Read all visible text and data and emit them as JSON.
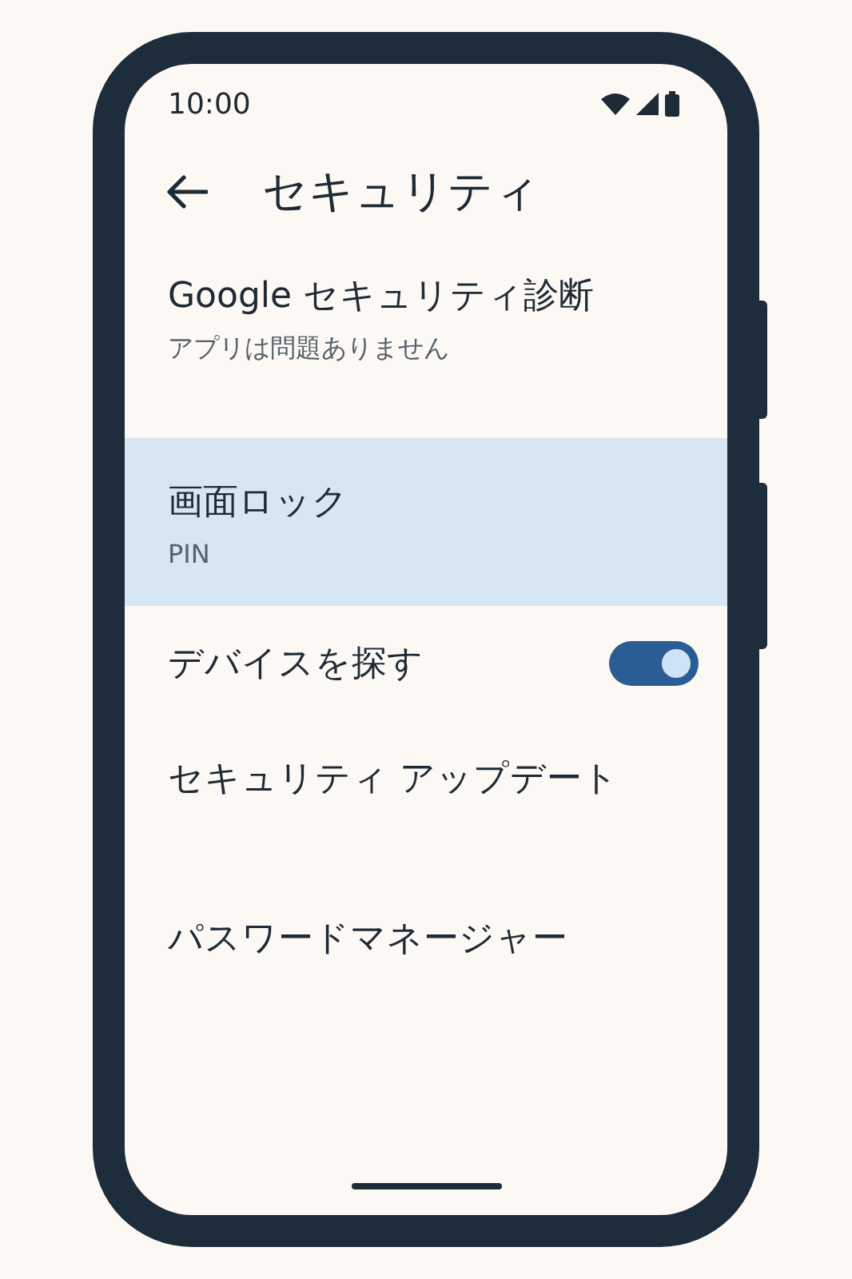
{
  "status_bar": {
    "time": "10:00"
  },
  "header": {
    "title": "セキュリティ"
  },
  "items": [
    {
      "kind": "info",
      "title": "Google セキュリティ診断",
      "subtitle": "アプリは問題ありません",
      "selected": false
    },
    {
      "kind": "info",
      "title": "画面ロック",
      "subtitle": "PIN",
      "selected": true
    },
    {
      "kind": "toggle",
      "title": "デバイスを探す",
      "on": true,
      "selected": false
    },
    {
      "kind": "plain",
      "title": "セキュリティ アップデート",
      "selected": false
    },
    {
      "kind": "plain",
      "title": "パスワードマネージャー",
      "selected": false
    }
  ]
}
